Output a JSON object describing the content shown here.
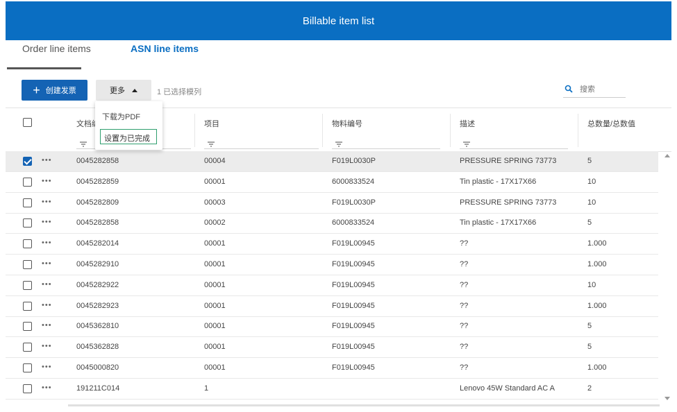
{
  "header": {
    "title": "Billable item list"
  },
  "tabs": [
    {
      "label": "Order line items",
      "active": true
    },
    {
      "label": "ASN line items",
      "active": false
    }
  ],
  "toolbar": {
    "create_label": "创建发票",
    "more_label": "更多",
    "selected_text": "1 已选择模列",
    "search_placeholder": "搜索"
  },
  "dropdown": {
    "items": [
      "下载为PDF",
      "设置为已完成"
    ]
  },
  "table": {
    "columns": [
      "文档编号",
      "项目",
      "物料编号",
      "描述",
      "总数量/总数值"
    ],
    "rows": [
      {
        "checked": true,
        "doc": "0045282858",
        "item": "00004",
        "material": "F019L0030P",
        "desc": "PRESSURE SPRING 73773",
        "qty": "5"
      },
      {
        "checked": false,
        "doc": "0045282859",
        "item": "00001",
        "material": "6000833524",
        "desc": "Tin plastic - 17X17X66",
        "qty": "10"
      },
      {
        "checked": false,
        "doc": "0045282809",
        "item": "00003",
        "material": "F019L0030P",
        "desc": "PRESSURE SPRING 73773",
        "qty": "10"
      },
      {
        "checked": false,
        "doc": "0045282858",
        "item": "00002",
        "material": "6000833524",
        "desc": "Tin plastic - 17X17X66",
        "qty": "5"
      },
      {
        "checked": false,
        "doc": "0045282014",
        "item": "00001",
        "material": "F019L00945",
        "desc": "??",
        "qty": "1.000"
      },
      {
        "checked": false,
        "doc": "0045282910",
        "item": "00001",
        "material": "F019L00945",
        "desc": "??",
        "qty": "1.000"
      },
      {
        "checked": false,
        "doc": "0045282922",
        "item": "00001",
        "material": "F019L00945",
        "desc": "??",
        "qty": "10"
      },
      {
        "checked": false,
        "doc": "0045282923",
        "item": "00001",
        "material": "F019L00945",
        "desc": "??",
        "qty": "1.000"
      },
      {
        "checked": false,
        "doc": "0045362810",
        "item": "00001",
        "material": "F019L00945",
        "desc": "??",
        "qty": "5"
      },
      {
        "checked": false,
        "doc": "0045362828",
        "item": "00001",
        "material": "F019L00945",
        "desc": "??",
        "qty": "5"
      },
      {
        "checked": false,
        "doc": "0045000820",
        "item": "00001",
        "material": "F019L00945",
        "desc": "??",
        "qty": "1.000"
      },
      {
        "checked": false,
        "doc": "191211C014",
        "item": "1",
        "material": "",
        "desc": "Lenovo 45W Standard AC A",
        "qty": "2"
      }
    ]
  },
  "colors": {
    "accent": "#0a6ec2",
    "button": "#1463b4",
    "highlight_border": "#2e9e6e"
  }
}
